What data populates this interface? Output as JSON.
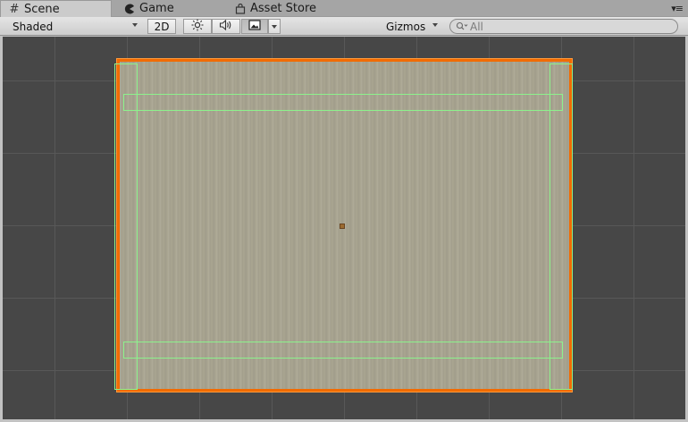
{
  "tabs": [
    {
      "label": "Scene",
      "icon": "scene-grid-icon",
      "active": true
    },
    {
      "label": "Game",
      "icon": "game-pacman-icon",
      "active": false
    },
    {
      "label": "Asset Store",
      "icon": "asset-store-bag-icon",
      "active": false
    }
  ],
  "toolbar": {
    "draw_mode": "Shaded",
    "mode_2d_label": "2D",
    "lighting_icon": "sun-icon",
    "audio_icon": "speaker-icon",
    "effects_icon": "image-icon",
    "gizmos_label": "Gizmos",
    "search_placeholder": "All"
  },
  "colors": {
    "selection_outline": "#f26b00",
    "collider": "#8cf28c",
    "viewport_bg": "#474747",
    "sprite_fill": "#a9a591"
  }
}
